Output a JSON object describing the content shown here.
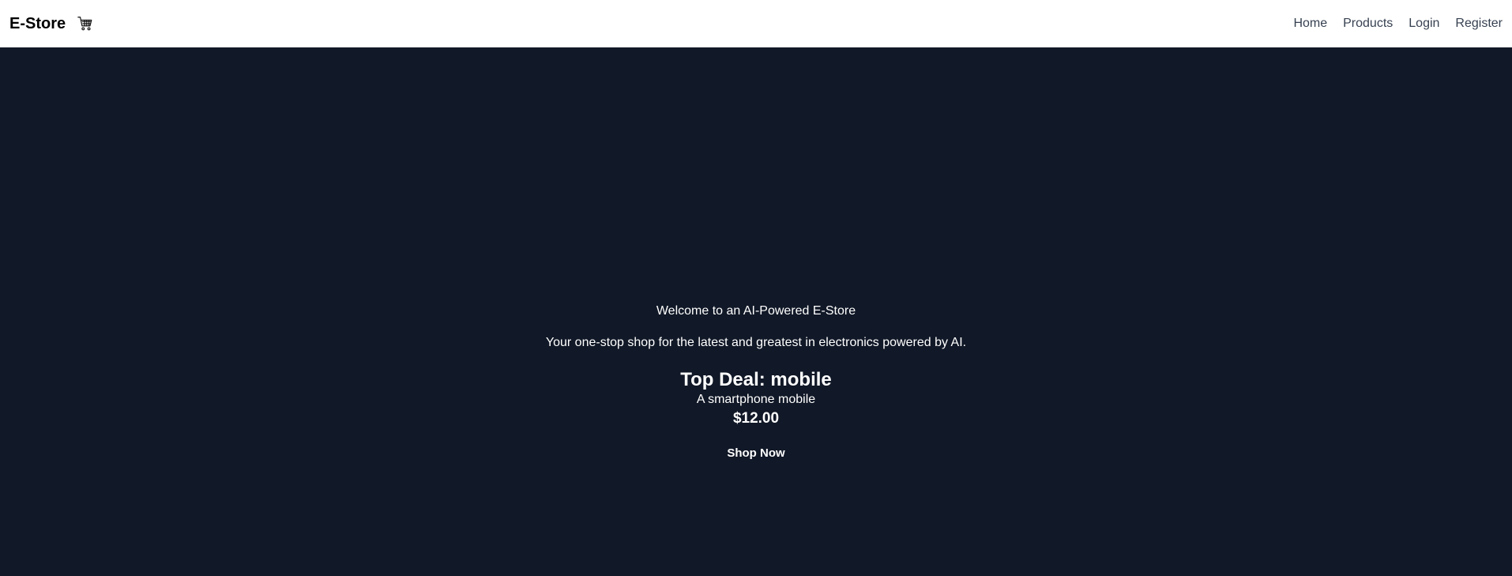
{
  "navbar": {
    "brand": "E-Store",
    "cart_icon": "shopping-cart-icon",
    "links": [
      "Home",
      "Products",
      "Login",
      "Register"
    ]
  },
  "hero": {
    "title": "Welcome to an AI-Powered E-Store",
    "subtitle": "Your one-stop shop for the latest and greatest in electronics powered by AI.",
    "deal": {
      "title": "Top Deal: mobile",
      "description": "A smartphone mobile",
      "price": "$12.00",
      "button_label": "Shop Now"
    }
  },
  "colors": {
    "navbar_bg": "#ffffff",
    "hero_bg": "#111827",
    "nav_link": "#374151",
    "hero_text": "#ffffff"
  }
}
